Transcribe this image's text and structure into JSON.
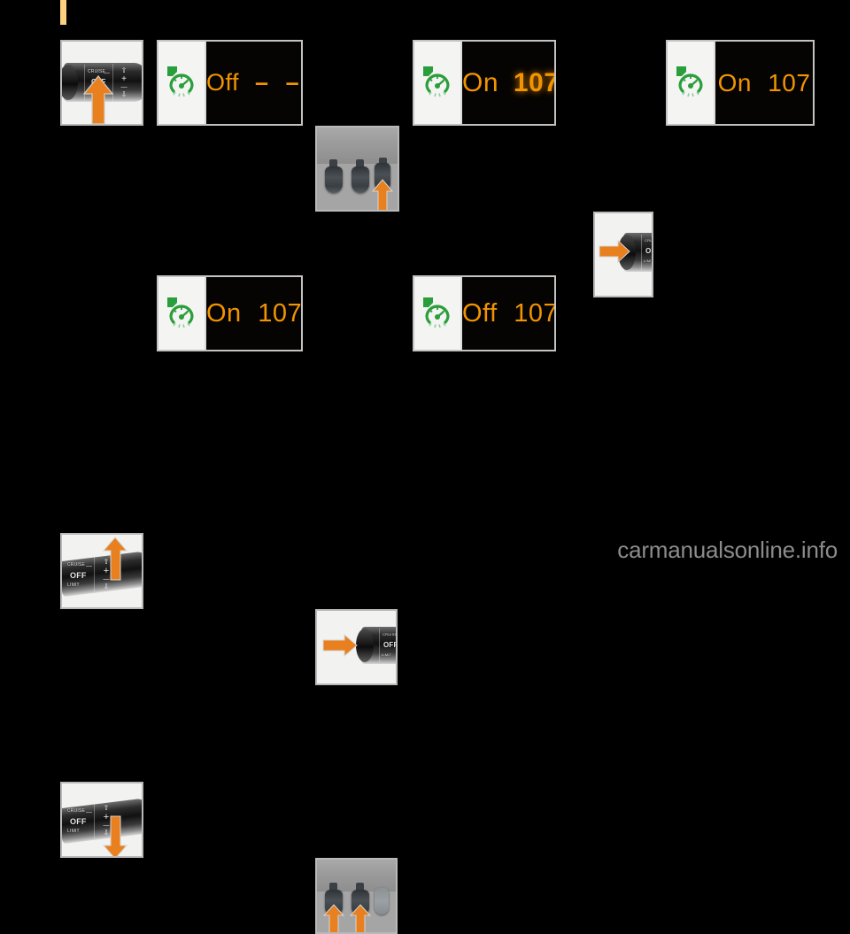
{
  "page": {
    "background_color": "#000000",
    "corner_marker_color": "#ffcf80",
    "watermark": "carmanualsonline.info"
  },
  "colors": {
    "display_orange": "#f29400",
    "icon_green": "#2a9e3c",
    "arrow_orange": "#e8801f",
    "panel_background": "#f2f2f0",
    "panel_border": "#b9b9b9",
    "screen_background": "#060402"
  },
  "stalk_labels": {
    "cruise": "CRUISE",
    "off": "OFF",
    "limit": "LIMIT",
    "up_glyph": "⇧",
    "plus_glyph": "+",
    "minus_glyph": "—",
    "down_glyph": "⇩",
    "dash_glyph": "—",
    "mem_glyph": "↻"
  },
  "rows": [
    {
      "row_id": "row-1",
      "steps": [
        {
          "kind": "photo",
          "name": "stalk-rotate-up-to-cruise",
          "caption": "steering column stalk with upward rotation arrow"
        },
        {
          "kind": "display",
          "name": "cluster-off-dashes",
          "icon": "speedometer-icon",
          "status": "Off",
          "value": "–  –",
          "value_bold": false
        },
        {
          "kind": "pedals",
          "name": "accelerator-pedal-press",
          "arrows": 1
        },
        {
          "kind": "display",
          "name": "cluster-on-107-bold",
          "icon": "speedometer-icon",
          "status": "On",
          "value": "107",
          "value_bold": true
        },
        {
          "kind": "photo",
          "name": "stalk-push-forward",
          "caption": "stalk pushed forward, horizontal arrow"
        },
        {
          "kind": "display",
          "name": "cluster-on-107",
          "icon": "speedometer-icon",
          "status": "On",
          "value": "107",
          "value_bold": false
        }
      ]
    },
    {
      "row_id": "row-2",
      "steps": [
        {
          "kind": "photo",
          "name": "stalk-rocker-up",
          "caption": "stalk rocker pressed upward"
        },
        {
          "kind": "display",
          "name": "cluster-on-107-row2",
          "icon": "speedometer-icon",
          "status": "On",
          "value": "107",
          "value_bold": false
        },
        {
          "kind": "photo",
          "name": "stalk-push-forward-row2",
          "caption": "stalk pushed forward, horizontal arrow"
        },
        {
          "kind": "display",
          "name": "cluster-off-107",
          "icon": "speedometer-icon",
          "status": "Off",
          "value": "107",
          "value_bold": false
        }
      ]
    },
    {
      "row_id": "row-3",
      "steps": [
        {
          "kind": "photo",
          "name": "stalk-rocker-down",
          "caption": "stalk rocker pressed downward"
        },
        {
          "kind": "pedals",
          "name": "brake-and-accelerator-press",
          "arrows": 2
        }
      ]
    }
  ]
}
